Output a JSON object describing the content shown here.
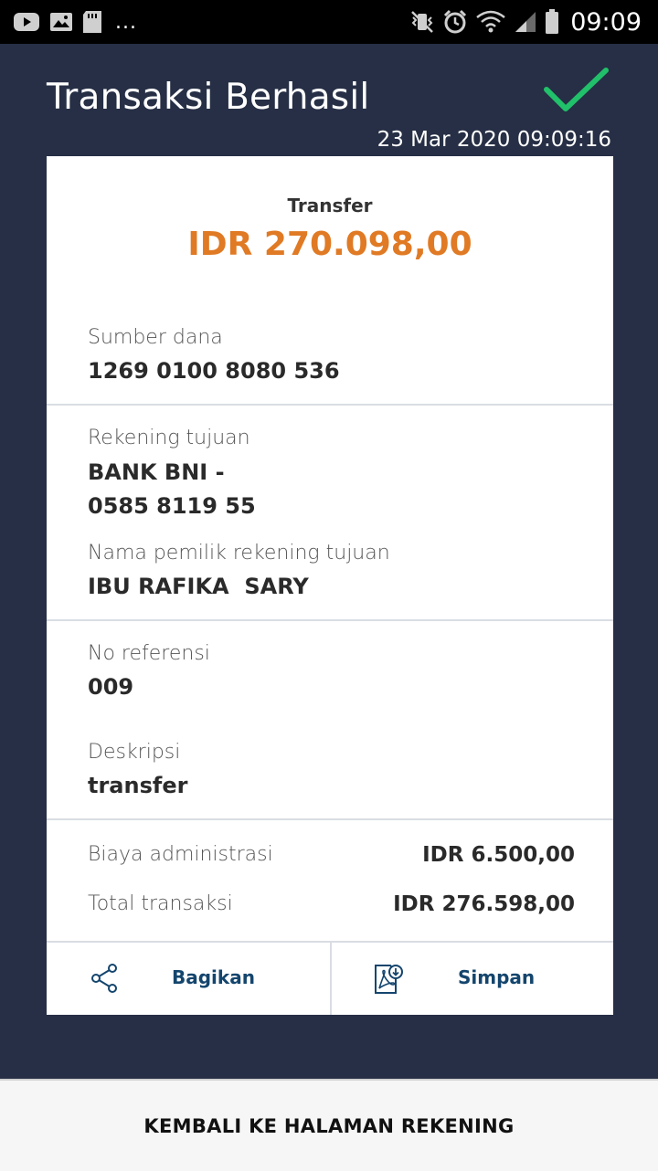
{
  "status_bar": {
    "left_icons": [
      "youtube-icon",
      "gallery-icon",
      "sd-card-icon"
    ],
    "overflow": "...",
    "right_icons": [
      "vibrate-mute-icon",
      "alarm-icon",
      "wifi-icon",
      "signal-icon",
      "battery-icon"
    ],
    "time": "09:09"
  },
  "header": {
    "title": "Transaksi Berhasil",
    "datetime": "23 Mar 2020 09:09:16",
    "success_color": "#21c06a"
  },
  "summary": {
    "type": "Transfer",
    "amount": "IDR 270.098,00",
    "amount_color": "#e07a24"
  },
  "source": {
    "label": "Sumber dana",
    "value": "1269 0100 8080 536"
  },
  "destination": {
    "label": "Rekening tujuan",
    "bank": "BANK BNI -",
    "account": "0585 8119 55",
    "owner_label": "Nama pemilik rekening tujuan",
    "owner": "IBU RAFIKA  SARY"
  },
  "reference": {
    "label": "No referensi",
    "value": "009",
    "desc_label": "Deskripsi",
    "desc_value": "transfer"
  },
  "fees": {
    "admin_label": "Biaya administrasi",
    "admin_value": "IDR 6.500,00",
    "total_label": "Total transaksi",
    "total_value": "IDR 276.598,00"
  },
  "actions": {
    "share_label": "Bagikan",
    "save_label": "Simpan",
    "accent": "#14456d"
  },
  "bottom": {
    "back_label": "KEMBALI KE HALAMAN REKENING"
  }
}
